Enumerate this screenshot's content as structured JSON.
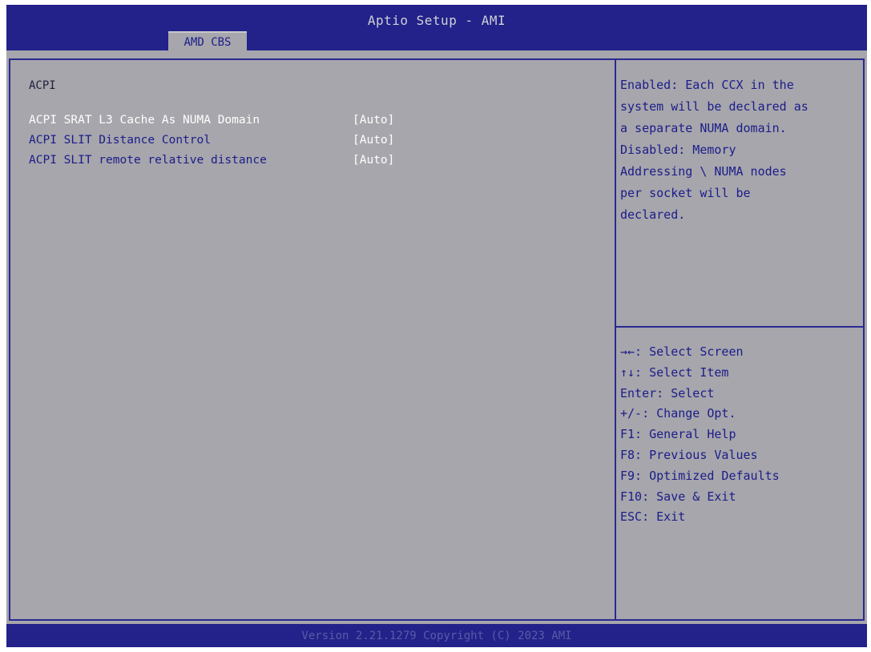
{
  "window": {
    "title": "Aptio Setup - AMI"
  },
  "tabs": [
    {
      "label": "AMD CBS"
    }
  ],
  "main": {
    "section_title": "ACPI",
    "settings": [
      {
        "label": "ACPI SRAT L3 Cache As NUMA Domain",
        "value": "[Auto]"
      },
      {
        "label": "ACPI SLIT Distance Control",
        "value": "[Auto]"
      },
      {
        "label": "ACPI SLIT remote relative distance",
        "value": "[Auto]"
      }
    ]
  },
  "help": {
    "lines": [
      "Enabled: Each CCX in the",
      "system will be declared as",
      "a separate NUMA domain.",
      "Disabled: Memory",
      "Addressing \\ NUMA nodes",
      "per socket will be",
      "declared."
    ]
  },
  "keys": [
    "→←: Select Screen",
    "↑↓: Select Item",
    "Enter: Select",
    "+/-: Change Opt.",
    "F1: General Help",
    "F8: Previous Values",
    "F9: Optimized Defaults",
    "F10: Save & Exit",
    "ESC: Exit"
  ],
  "footer": {
    "text": "Version 2.21.1279 Copyright (C) 2023 AMI"
  },
  "colors": {
    "header_bg": "#22228a",
    "panel_bg": "#a6a6ac",
    "text_blue": "#1c1c8a",
    "selected_text": "#ffffff"
  }
}
